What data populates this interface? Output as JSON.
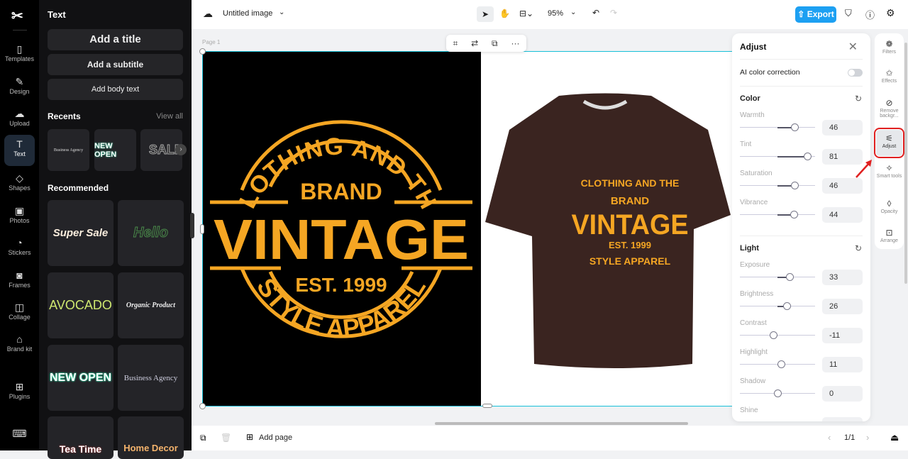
{
  "rail": {
    "items": [
      {
        "label": "Templates",
        "icon": "templates-icon"
      },
      {
        "label": "Design",
        "icon": "design-icon"
      },
      {
        "label": "Upload",
        "icon": "upload-icon"
      },
      {
        "label": "Text",
        "icon": "text-icon"
      },
      {
        "label": "Shapes",
        "icon": "shapes-icon"
      },
      {
        "label": "Photos",
        "icon": "photos-icon"
      },
      {
        "label": "Stickers",
        "icon": "stickers-icon"
      },
      {
        "label": "Frames",
        "icon": "frames-icon"
      },
      {
        "label": "Collage",
        "icon": "collage-icon"
      },
      {
        "label": "Brand kit",
        "icon": "brand-kit-icon"
      },
      {
        "label": "Plugins",
        "icon": "plugins-icon"
      }
    ]
  },
  "panel": {
    "title": "Text",
    "add_title": "Add a title",
    "add_subtitle": "Add a subtitle",
    "add_body": "Add body text",
    "recents": "Recents",
    "view_all": "View all",
    "recommended": "Recommended",
    "recent_tiles": [
      "Business Agency",
      "NEW OPEN",
      "SALE"
    ],
    "rec_tiles": [
      "Super Sale",
      "Hello",
      "AVOCADO",
      "Organic Product",
      "NEW OPEN",
      "Business Agency",
      "Tea Time",
      "Home Decor"
    ]
  },
  "top": {
    "doc_title": "Untitled image",
    "zoom": "95%",
    "export": "Export"
  },
  "canvas": {
    "page_label": "Page 1",
    "logo": {
      "top": "CLOTHING AND THE",
      "brand": "BRAND",
      "main": "VINTAGE",
      "est": "EST. 1999",
      "bottom": "STYLE APPAREL"
    }
  },
  "adjust": {
    "title": "Adjust",
    "ai": "AI color correction",
    "ai_on": false,
    "color_title": "Color",
    "color": [
      {
        "label": "Warmth",
        "value": 46
      },
      {
        "label": "Tint",
        "value": 81
      },
      {
        "label": "Saturation",
        "value": 46
      },
      {
        "label": "Vibrance",
        "value": 44
      }
    ],
    "light_title": "Light",
    "light": [
      {
        "label": "Exposure",
        "value": 33
      },
      {
        "label": "Brightness",
        "value": 26
      },
      {
        "label": "Contrast",
        "value": -11
      },
      {
        "label": "Highlight",
        "value": 11
      },
      {
        "label": "Shadow",
        "value": 0
      }
    ],
    "shine": "Shine"
  },
  "right_rail": [
    {
      "label": "Filters"
    },
    {
      "label": "Effects"
    },
    {
      "label": "Remove backgr..."
    },
    {
      "label": "Adjust"
    },
    {
      "label": "Smart tools"
    },
    {
      "label": "Opacity"
    },
    {
      "label": "Arrange"
    }
  ],
  "bottom": {
    "add_page": "Add page",
    "pages": "1/1"
  },
  "colors": {
    "accent": "#1da0f2",
    "logo": "#f5a623",
    "highlight_box": "#e02020"
  }
}
